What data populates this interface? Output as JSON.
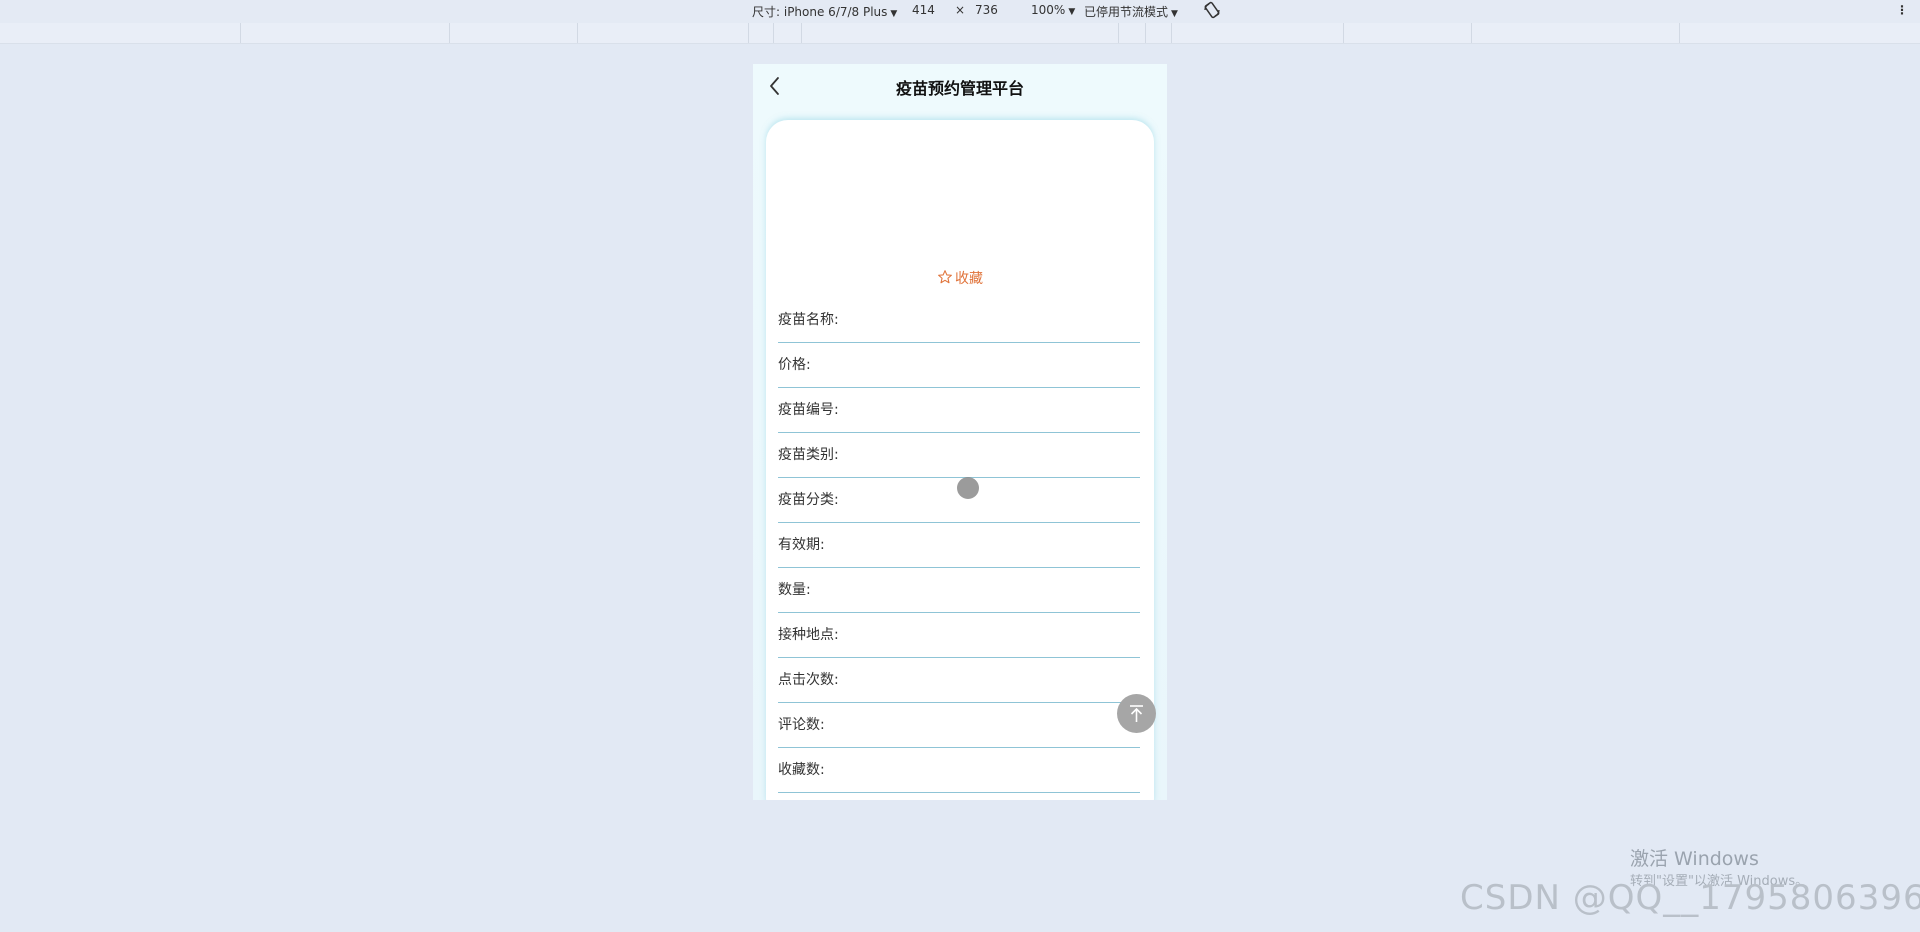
{
  "devtools": {
    "dimensions_label": "尺寸: iPhone 6/7/8 Plus",
    "width": "414",
    "times": "×",
    "height": "736",
    "zoom": "100%",
    "throttle": "已停用节流模式",
    "more": "⋮"
  },
  "app": {
    "title": "疫苗预约管理平台"
  },
  "detail": {
    "favorite_label": "收藏",
    "fields": [
      {
        "label": "疫苗名称:",
        "value": ""
      },
      {
        "label": "价格:",
        "value": ""
      },
      {
        "label": "疫苗编号:",
        "value": ""
      },
      {
        "label": "疫苗类别:",
        "value": ""
      },
      {
        "label": "疫苗分类:",
        "value": ""
      },
      {
        "label": "有效期:",
        "value": ""
      },
      {
        "label": "数量:",
        "value": ""
      },
      {
        "label": "接种地点:",
        "value": ""
      },
      {
        "label": "点击次数:",
        "value": ""
      },
      {
        "label": "评论数:",
        "value": ""
      },
      {
        "label": "收藏数:",
        "value": ""
      }
    ]
  },
  "overlay": {
    "windows_activate": "激活 Windows",
    "windows_hint": "转到\"设置\"以激活 Windows。",
    "csdn": "CSDN @QQ__1795806396"
  },
  "colors": {
    "page_bg": "#e2e9f4",
    "accent_orange": "#e0733a",
    "divider": "#8fc4d6"
  }
}
